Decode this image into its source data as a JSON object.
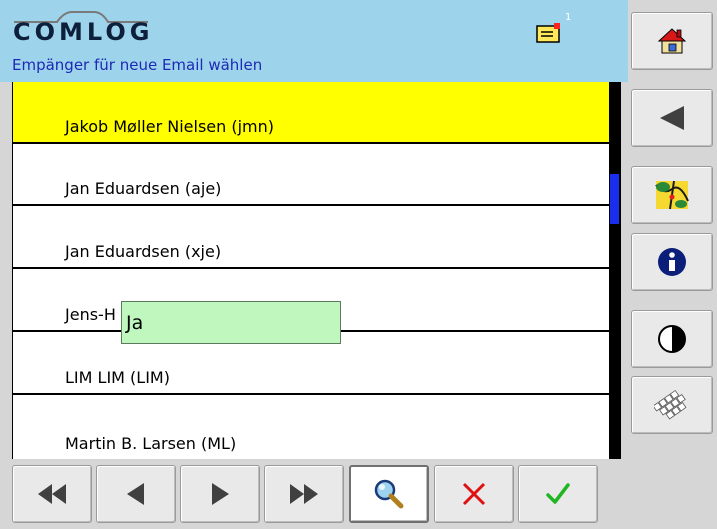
{
  "header": {
    "logo_text": "COMLOG",
    "subtitle": "Empänger für neue Email wählen",
    "mail_count": "1"
  },
  "contacts": [
    {
      "label": "Jakob Møller Nielsen (jmn)",
      "selected": true
    },
    {
      "label": "Jan Eduardsen (aje)",
      "selected": false
    },
    {
      "label": "Jan Eduardsen (xje)",
      "selected": false
    },
    {
      "label": "Jens-H",
      "selected": false
    },
    {
      "label": "LIM LIM (LIM)",
      "selected": false
    },
    {
      "label": "Martin B. Larsen (ML)",
      "selected": false
    }
  ],
  "search": {
    "value": "Ja"
  },
  "scroll": {
    "position_fraction": 0.28
  },
  "sidebar": {
    "buttons": [
      "home-icon",
      "back-icon",
      "map-icon",
      "info-icon",
      "contrast-icon",
      "keyboard-icon"
    ]
  },
  "toolbar": {
    "buttons": [
      "first-page-icon",
      "previous-icon",
      "next-icon",
      "last-page-icon",
      "search-icon",
      "cancel-icon",
      "confirm-icon"
    ]
  },
  "colors": {
    "header_bg": "#9ed3ec",
    "selected_row": "#ffff00",
    "subtitle": "#1d2ab5",
    "search_bg": "#bff7bf",
    "scroll_thumb": "#1a2ef0",
    "cancel": "#e01010",
    "confirm": "#22b522"
  }
}
